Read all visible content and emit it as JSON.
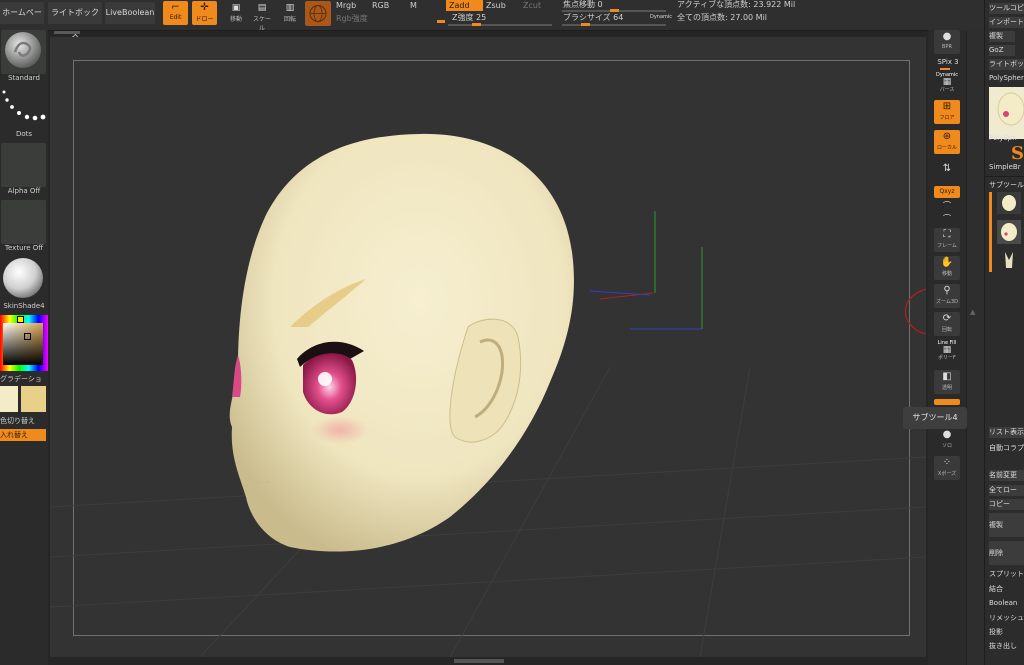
{
  "top_menu": {
    "home_page": "ホームページ",
    "lightbox": "ライトボックス",
    "live_boolean": "LiveBoolean"
  },
  "transform_buttons": {
    "edit": "Edit",
    "draw": "ドロー",
    "move": "移動",
    "scale": "スケール",
    "rotate": "回転"
  },
  "rgb_controls": {
    "mrgb": "Mrgb",
    "rgb": "RGB",
    "m": "M",
    "rgb_intensity": "Rgb強度"
  },
  "z_controls": {
    "zadd": "Zadd",
    "zsub": "Zsub",
    "zcut": "Zcut",
    "z_intensity": "Z強度 25"
  },
  "sliders": {
    "focal_shift": "焦点移動 0",
    "brush_size": "ブラシサイズ 64",
    "dynamic": "Dynamic",
    "z_intensity_level": 0.25,
    "focal_shift_level": 0.5,
    "brush_size_level": 0.2
  },
  "stats": {
    "active_points": "アクティブな頂点数: 23.922 Mil",
    "total_points": "全ての頂点数: 27.00 Mil"
  },
  "left_panel": {
    "brush": "Standard",
    "stroke": "Dots",
    "alpha": "Alpha Off",
    "texture": "Texture Off",
    "material": "SkinShade4",
    "gradient": "グラデーション",
    "switch_color": "色切り替え",
    "swap": "入れ替え"
  },
  "right_shelf": {
    "bpr": "BPR",
    "spix": "SPix 3",
    "dynamic_persp": "Dynamic",
    "persp": "パース",
    "floor": "フロア",
    "local": "ローカル",
    "xyz": "Qxyz",
    "frame": "フレーム",
    "move": "移動",
    "zoom3d": "ズーム3D",
    "rotate": "回転",
    "line_fill": "Line Fill",
    "polyf": "ポリーF",
    "transp": "透明",
    "solo": "ソロ",
    "xpose": "Xポーズ",
    "tooltip": "サブツール4"
  },
  "tool_panel": {
    "items": [
      "ツールコピ",
      "インポート",
      "複製",
      "GoZ",
      "ライトボックス",
      "PolySphere"
    ],
    "simple_brush": "SimpleBr",
    "polysphere_thumb": "PolySph",
    "subtool_header": "サブツール",
    "list_display": "リスト表示",
    "auto_collapse": "自動コラプス",
    "lower_items": [
      "名前変更",
      "全てロー",
      "コピー",
      "複製",
      "削除",
      "スプリット",
      "結合",
      "Boolean",
      "リメッシュ",
      "投影",
      "抜き出し"
    ]
  },
  "colors": {
    "accent": "#f08a1c",
    "background": "#262626",
    "viewport": "#333333",
    "skin": "#f3ecc7",
    "eye": "#d8437a"
  }
}
